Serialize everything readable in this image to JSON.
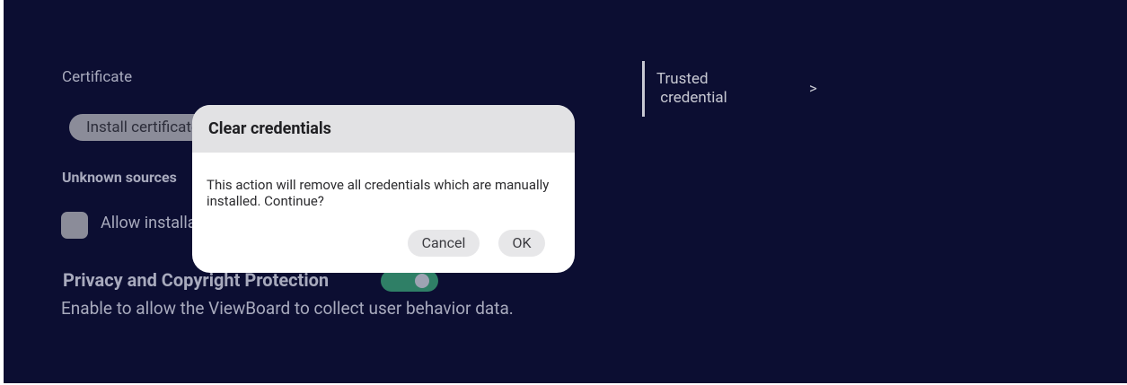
{
  "settings": {
    "certificate_heading": "Certificate",
    "install_button_label": "Install certificate",
    "unknown_sources_heading": "Unknown sources",
    "allow_install_label": "Allow installation",
    "privacy_heading": "Privacy and Copyright Protection",
    "privacy_toggle_on": true,
    "privacy_description": "Enable to allow the ViewBoard to collect user behavior data.",
    "trusted_credential_label": "Trusted\n credential",
    "chevron_glyph": ">"
  },
  "dialog": {
    "title": "Clear credentials",
    "message": "This action will remove all credentials which are manually installed. Continue?",
    "cancel_label": "Cancel",
    "ok_label": "OK"
  },
  "colors": {
    "background": "#0c0e32",
    "toggle_on": "#2f7f66",
    "dialog_header": "#e2e2e4"
  }
}
